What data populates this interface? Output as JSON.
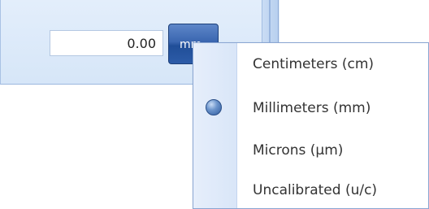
{
  "input": {
    "value": "0.00"
  },
  "unit_button": {
    "label": "mm"
  },
  "unit_menu": {
    "items": [
      {
        "label": "Centimeters (cm)",
        "selected": false
      },
      {
        "label": "Millimeters (mm)",
        "selected": true
      },
      {
        "label": "Microns (µm)",
        "selected": false
      },
      {
        "label": "Uncalibrated (u/c)",
        "selected": false
      }
    ]
  },
  "colors": {
    "panel_bg": "#dbe8f8",
    "button_blue": "#2d5ca8",
    "radio_blue": "#3a66b0"
  },
  "icons": {
    "selected_indicator": "radio-selected-icon"
  }
}
